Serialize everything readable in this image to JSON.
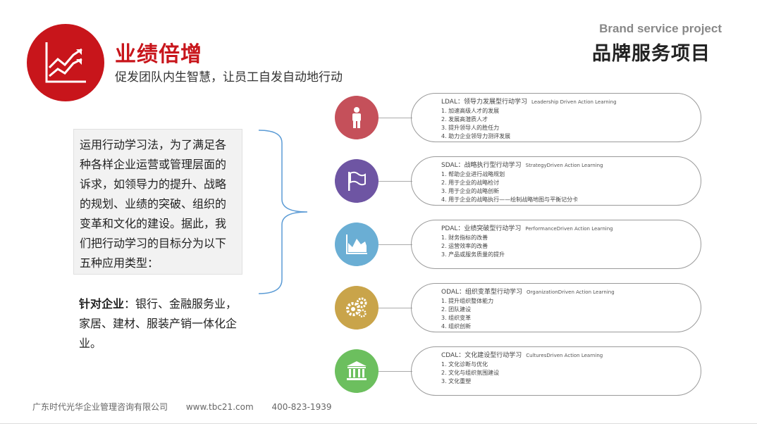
{
  "header": {
    "title": "业绩倍增",
    "subtitle": "促发团队内生智慧，让员工自发自动地行动",
    "brand_en": "Brand service project",
    "brand_cn": "品牌服务项目",
    "logo_icon": "growth-chart-icon"
  },
  "intro": {
    "text": "运用行动学习法，为了满足各种各样企业运营或管理层面的诉求，如领导力的提升、战略的规划、业绩的突破、组织的变革和文化的建设。据此，我们把行动学习的目标分为以下五种应用类型："
  },
  "target": {
    "label": "针对企业",
    "text": "：银行、金融服务业，家居、建材、服装产销一体化企业。"
  },
  "items": [
    {
      "title": "LDAL：领导力发展型行动学习",
      "en": "Leadership Driven Action Learning",
      "icon": "person-icon",
      "color": "#c5505a",
      "lines": [
        "1. 加速高级人才的发展",
        "2. 发展高潜质人才",
        "3. 提升领导人的胜任力",
        "4. 助力企业领导力测评发展"
      ]
    },
    {
      "title": "SDAL：战略执行型行动学习",
      "en": "StrategyDriven Action Learning",
      "icon": "flag-icon",
      "color": "#6e55a3",
      "lines": [
        "1. 帮助企业进行战略规划",
        "2. 用于企业的战略检讨",
        "3. 用于企业的战略创新",
        "4. 用于企业的战略执行——绘制战略地图与平衡记分卡"
      ]
    },
    {
      "title": "PDAL：业绩突破型行动学习",
      "en": "PerformanceDriven Action Learning",
      "icon": "area-chart-icon",
      "color": "#6aaed4",
      "lines": [
        "1. 财务指标的改善",
        "2. 运营效率的改善",
        "3. 产品或服务质量的提升"
      ]
    },
    {
      "title": "ODAL：组织变革型行动学习",
      "en": "OrganizationDriven Action Learning",
      "icon": "gears-icon",
      "color": "#c9a44a",
      "lines": [
        "1. 提升组织整体能力",
        "2. 团队建设",
        "3. 组织变革",
        "4. 组织创新"
      ]
    },
    {
      "title": "CDAL：文化建设型行动学习",
      "en": "CulturesDriven Action Learning",
      "icon": "institution-icon",
      "color": "#6cbf5e",
      "lines": [
        "1. 文化诊断与优化",
        "2. 文化与组织氛围建设",
        "3. 文化重塑"
      ]
    }
  ],
  "footer": {
    "company": "广东时代光华企业管理咨询有限公司",
    "website": "www.tbc21.com",
    "phone": "400-823-1939"
  }
}
